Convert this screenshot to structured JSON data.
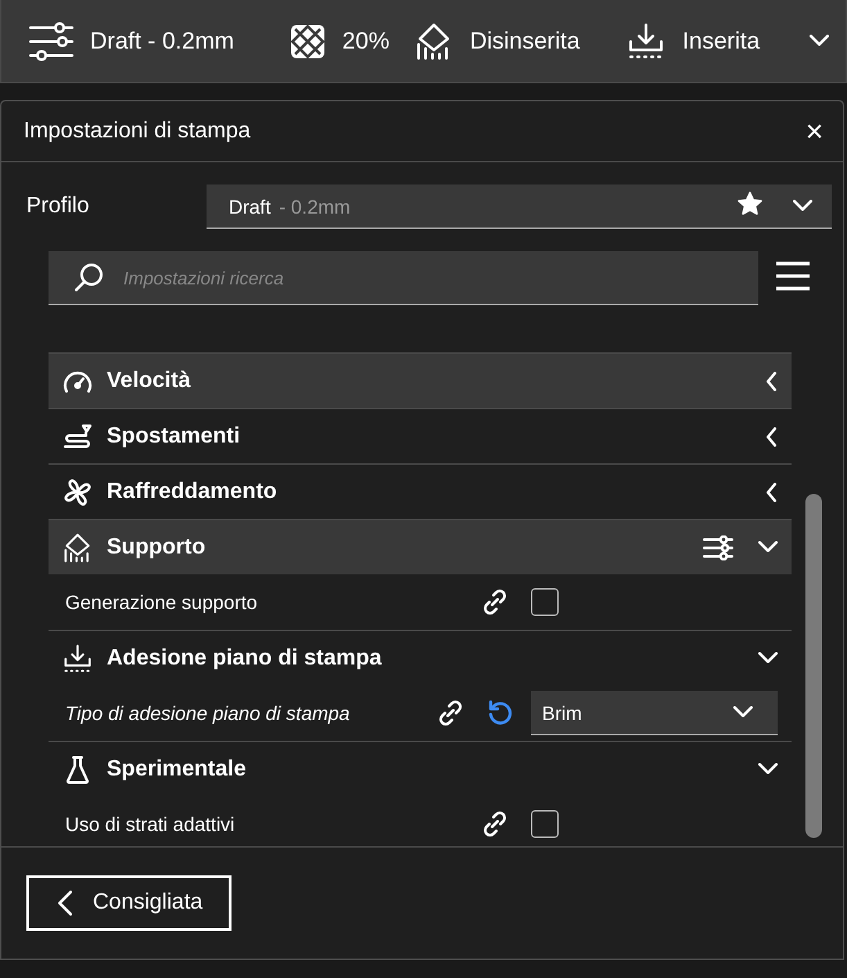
{
  "toolbar": {
    "profile": "Draft - 0.2mm",
    "infill": "20%",
    "support": "Disinserita",
    "adhesion": "Inserita"
  },
  "panel": {
    "title": "Impostazioni di stampa",
    "close": "×",
    "profile_label": "Profilo",
    "profile": {
      "name": "Draft",
      "detail": "- 0.2mm",
      "favorite": true
    },
    "search": {
      "placeholder": "Impostazioni ricerca"
    },
    "items": [
      {
        "kind": "category",
        "label": "Velocità",
        "expanded": false,
        "highlighted": true,
        "visibility_button": false
      },
      {
        "kind": "category",
        "label": "Spostamenti",
        "expanded": false,
        "highlighted": false,
        "visibility_button": false
      },
      {
        "kind": "category",
        "label": "Raffreddamento",
        "expanded": false,
        "highlighted": false,
        "visibility_button": false
      },
      {
        "kind": "category",
        "label": "Supporto",
        "expanded": true,
        "highlighted": true,
        "visibility_button": true
      },
      {
        "kind": "checkbox",
        "label": "Generazione supporto",
        "modified": false,
        "checked": false
      },
      {
        "kind": "category",
        "label": "Adesione piano di stampa",
        "expanded": true,
        "highlighted": false,
        "visibility_button": false
      },
      {
        "kind": "dropdown",
        "label": "Tipo di adesione piano di stampa",
        "modified": true,
        "value": "Brim"
      },
      {
        "kind": "category",
        "label": "Sperimentale",
        "expanded": true,
        "highlighted": false,
        "visibility_button": false
      },
      {
        "kind": "checkbox",
        "label": "Uso di strati adattivi",
        "modified": false,
        "checked": false
      }
    ],
    "back_button": "Consigliata"
  }
}
